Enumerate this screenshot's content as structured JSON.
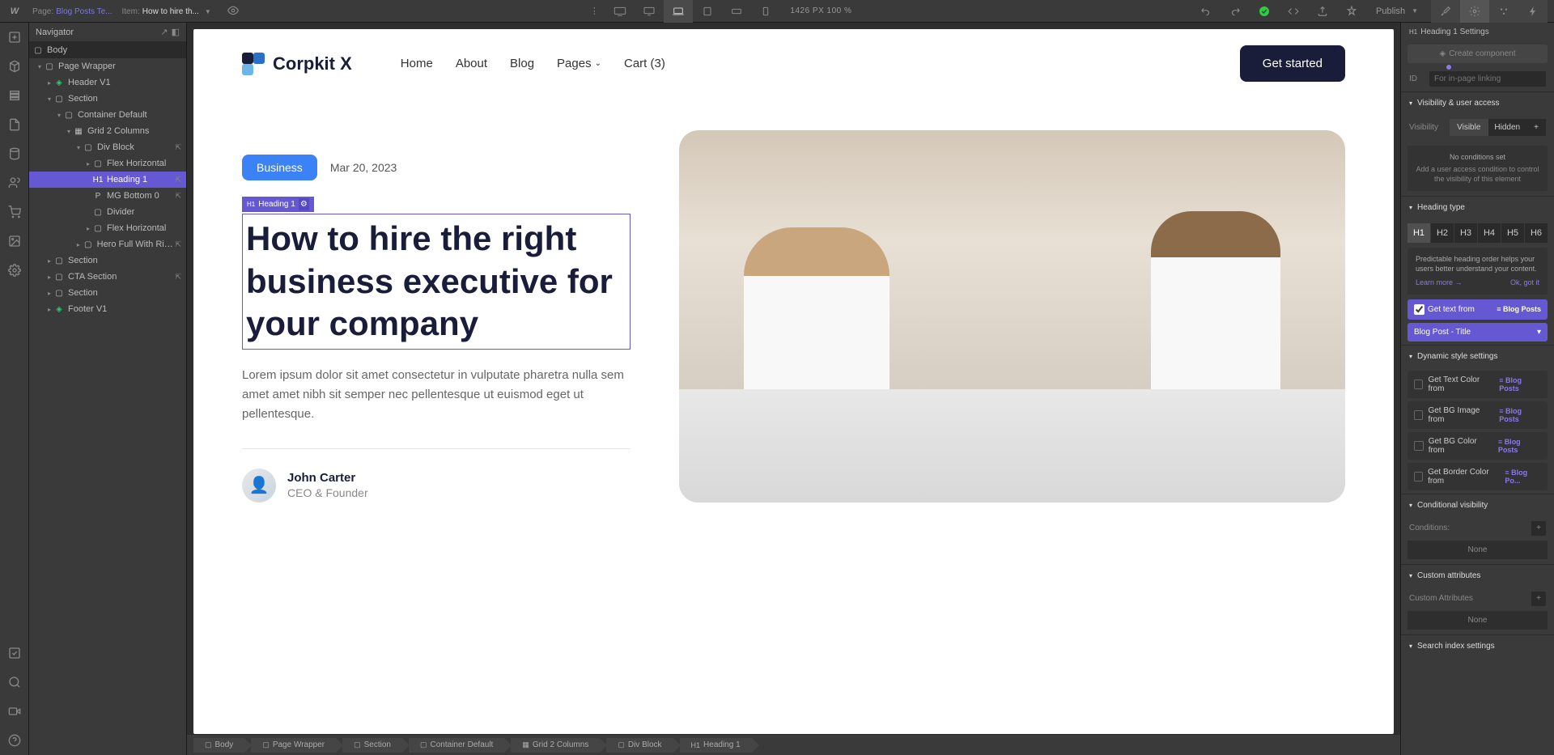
{
  "topbar": {
    "page_label": "Page:",
    "page_name": "Blog Posts Te...",
    "item_label": "Item:",
    "item_name": "How to hire th...",
    "dimensions": "1426 PX  100 %",
    "publish": "Publish"
  },
  "navigator": {
    "title": "Navigator",
    "tree": {
      "body": "Body",
      "page_wrapper": "Page Wrapper",
      "header_v1": "Header V1",
      "section1": "Section",
      "container_default": "Container Default",
      "grid_2_cols": "Grid 2 Columns",
      "div_block": "Div Block",
      "flex_h1": "Flex Horizontal",
      "heading1": "Heading 1",
      "mg_bottom": "MG Bottom 0",
      "divider": "Divider",
      "flex_h2": "Flex Horizontal",
      "hero_full": "Hero Full With Right",
      "section2": "Section",
      "cta_section": "CTA Section",
      "section3": "Section",
      "footer_v1": "Footer V1"
    }
  },
  "site": {
    "brand": "Corpkit X",
    "nav": {
      "home": "Home",
      "about": "About",
      "blog": "Blog",
      "pages": "Pages",
      "cart": "Cart (3)"
    },
    "cta": "Get started"
  },
  "post": {
    "category": "Business",
    "date": "Mar 20, 2023",
    "element_tag": "Heading 1",
    "title": "How to hire the right business executive for your company",
    "excerpt": "Lorem ipsum dolor sit amet consectetur in vulputate pharetra nulla sem amet amet nibh sit semper nec pellentesque ut euismod eget ut pellentesque.",
    "author_name": "John Carter",
    "author_role": "CEO & Founder"
  },
  "breadcrumb": [
    "Body",
    "Page Wrapper",
    "Section",
    "Container Default",
    "Grid 2 Columns",
    "Div Block",
    "Heading 1"
  ],
  "panel": {
    "header": "Heading 1 Settings",
    "create_component": "Create component",
    "id_label": "ID",
    "id_placeholder": "For in-page linking",
    "visibility_header": "Visibility & user access",
    "visibility_label": "Visibility",
    "visible": "Visible",
    "hidden": "Hidden",
    "no_conditions_title": "No conditions set",
    "no_conditions_body": "Add a user access condition to control the visibility of this element",
    "heading_type_header": "Heading type",
    "h_types": [
      "H1",
      "H2",
      "H3",
      "H4",
      "H5",
      "H6"
    ],
    "heading_tip": "Predictable heading order helps your users better understand your content.",
    "learn_more": "Learn more →",
    "ok_got_it": "Ok, got it",
    "get_text_from": "Get text from",
    "blog_posts": "Blog Posts",
    "blog_post_title": "Blog Post - Title",
    "dynamic_style_header": "Dynamic style settings",
    "dyn_text_color": "Get Text Color from",
    "dyn_bg_image": "Get BG Image from",
    "dyn_bg_color": "Get BG Color from",
    "dyn_border_color": "Get Border Color from",
    "blog_po": "Blog Po...",
    "conditional_vis_header": "Conditional visibility",
    "conditions_label": "Conditions:",
    "none": "None",
    "custom_attrs_header": "Custom attributes",
    "custom_attrs_label": "Custom Attributes",
    "search_index_header": "Search index settings"
  }
}
